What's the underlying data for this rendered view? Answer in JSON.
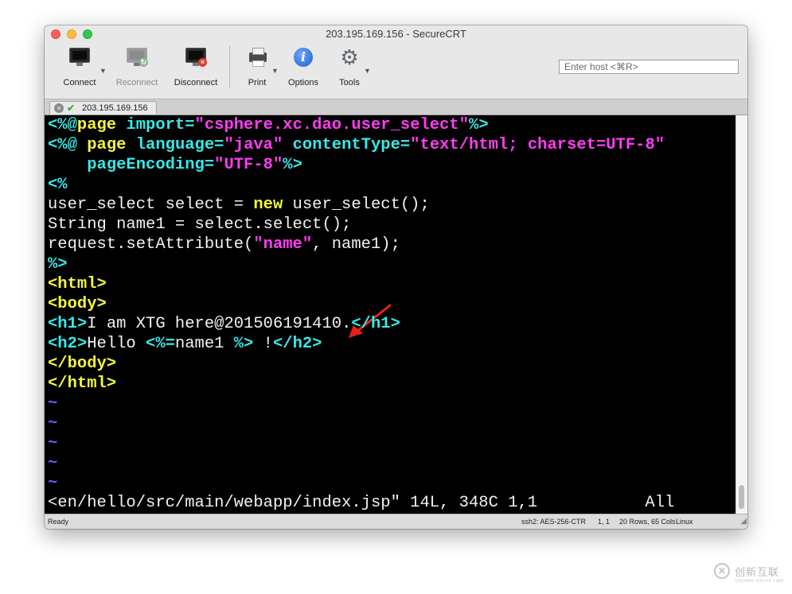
{
  "window": {
    "title": "203.195.169.156 - SecureCRT"
  },
  "toolbar": {
    "connect": "Connect",
    "reconnect": "Reconnect",
    "disconnect": "Disconnect",
    "print": "Print",
    "options": "Options",
    "tools": "Tools",
    "host_placeholder": "Enter host <⌘R>"
  },
  "tab": {
    "label": "203.195.169.156"
  },
  "terminal": {
    "lines": [
      [
        [
          "tag",
          "<%@"
        ],
        [
          "kw",
          "page "
        ],
        [
          "tag",
          "import"
        ],
        [
          "tag",
          "="
        ],
        [
          "str",
          "\"csphere.xc.dao.user_select\""
        ],
        [
          "tag",
          "%>"
        ]
      ],
      [
        [
          "tag",
          "<%@ "
        ],
        [
          "kw",
          "page "
        ],
        [
          "tag",
          "language"
        ],
        [
          "tag",
          "="
        ],
        [
          "str",
          "\"java\" "
        ],
        [
          "tag",
          "contentType"
        ],
        [
          "tag",
          "="
        ],
        [
          "str",
          "\"text/html; "
        ],
        [
          "str",
          "charset=UTF-8\""
        ]
      ],
      [
        [
          "txt",
          "    "
        ],
        [
          "tag",
          "pageEncoding"
        ],
        [
          "tag",
          "="
        ],
        [
          "str",
          "\"UTF-8\""
        ],
        [
          "tag",
          "%>"
        ]
      ],
      [
        [
          "tag",
          "<%"
        ]
      ],
      [
        [
          "txt",
          "user_select select = "
        ],
        [
          "kw",
          "new"
        ],
        [
          "txt",
          " user_select();"
        ]
      ],
      [
        [
          "txt",
          "String name1 = select.select();"
        ]
      ],
      [
        [
          "txt",
          "request.setAttribute("
        ],
        [
          "str",
          "\"name\""
        ],
        [
          "txt",
          ", name1);"
        ]
      ],
      [
        [
          "tag",
          "%>"
        ]
      ],
      [
        [
          "kw",
          "<html>"
        ]
      ],
      [
        [
          "kw",
          "<body>"
        ]
      ],
      [
        [
          "tag",
          "<h1>"
        ],
        [
          "txt",
          "I am XTG here@201506191410."
        ],
        [
          "tag",
          "</h1>"
        ]
      ],
      [
        [
          "tag",
          "<h2>"
        ],
        [
          "txt",
          "Hello "
        ],
        [
          "tag",
          "<%="
        ],
        [
          "txt",
          "name1 "
        ],
        [
          "tag",
          "%>"
        ],
        [
          "txt",
          " !"
        ],
        [
          "tag",
          "</h2>"
        ]
      ],
      [
        [
          "kw",
          "</body>"
        ]
      ],
      [
        [
          "kw",
          "</html>"
        ]
      ],
      [
        [
          "tilde",
          "~"
        ]
      ],
      [
        [
          "tilde",
          "~"
        ]
      ],
      [
        [
          "tilde",
          "~"
        ]
      ],
      [
        [
          "tilde",
          "~"
        ]
      ],
      [
        [
          "tilde",
          "~"
        ]
      ],
      [
        [
          "txt",
          "<en/hello/src/main/webapp/index.jsp\" 14L, 348C 1,1           All"
        ]
      ]
    ]
  },
  "statusbar": {
    "ready": "Ready",
    "ssh": "ssh2: AES-256-CTR",
    "position": "1, 1",
    "rows_cols": "20 Rows, 65 Cols",
    "os": "Linux"
  },
  "watermark": {
    "text": "创新互联",
    "sub": "CHUANG XIN HU LIAN"
  },
  "colors": {
    "terminal_bg": "#000000",
    "tag": "#38e8e8",
    "keyword": "#f4f440",
    "string": "#ff3df2",
    "text": "#f2f2f2",
    "tilde": "#7a52ff",
    "arrow": "#e8201c"
  }
}
